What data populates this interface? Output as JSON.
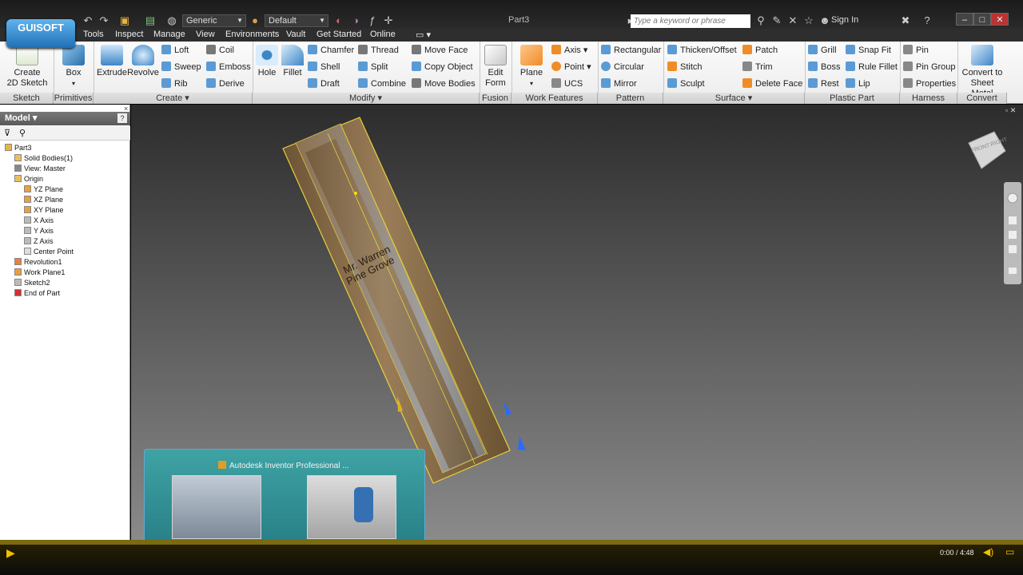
{
  "title_bar": {
    "style_combo": "Generic",
    "appearance_combo": "Default",
    "doc_title": "Part3",
    "search_placeholder": "Type a keyword or phrase",
    "sign_in": "Sign In",
    "logo_text": "GUISOFT"
  },
  "menu": [
    "Tools",
    "Inspect",
    "Manage",
    "View",
    "Environments",
    "Vault",
    "Get Started",
    "Online"
  ],
  "ribbon": {
    "sketch": {
      "create_2d_sketch": "Create\n2D Sketch",
      "panel": "Sketch"
    },
    "primitives": {
      "box": "Box",
      "panel": "Primitives"
    },
    "create": {
      "extrude": "Extrude",
      "revolve": "Revolve",
      "loft": "Loft",
      "coil": "Coil",
      "sweep": "Sweep",
      "emboss": "Emboss",
      "rib": "Rib",
      "derive": "Derive",
      "panel": "Create"
    },
    "modify": {
      "hole": "Hole",
      "fillet": "Fillet",
      "chamfer": "Chamfer",
      "thread": "Thread",
      "shell": "Shell",
      "split": "Split",
      "draft": "Draft",
      "combine": "Combine",
      "move_face": "Move Face",
      "copy_object": "Copy Object",
      "move_bodies": "Move Bodies",
      "panel": "Modify"
    },
    "fusion": {
      "edit_form": "Edit\nForm",
      "panel": "Fusion"
    },
    "work_features": {
      "plane": "Plane",
      "axis": "Axis",
      "point": "Point",
      "ucs": "UCS",
      "panel": "Work Features"
    },
    "pattern": {
      "rectangular": "Rectangular",
      "circular": "Circular",
      "mirror": "Mirror",
      "panel": "Pattern"
    },
    "surface": {
      "thicken_offset": "Thicken/Offset",
      "stitch": "Stitch",
      "sculpt": "Sculpt",
      "patch": "Patch",
      "trim": "Trim",
      "delete_face": "Delete Face",
      "panel": "Surface"
    },
    "plastic_part": {
      "grill": "Grill",
      "boss": "Boss",
      "rest": "Rest",
      "snap_fit": "Snap Fit",
      "rule_fillet": "Rule Fillet",
      "lip": "Lip",
      "panel": "Plastic Part"
    },
    "harness": {
      "pin": "Pin",
      "pin_group": "Pin Group",
      "properties": "Properties",
      "panel": "Harness"
    },
    "convert": {
      "convert_to_sheet_metal": "Convert to\nSheet Metal",
      "panel": "Convert"
    }
  },
  "browser": {
    "title": "Model",
    "tree": [
      {
        "label": "Part3",
        "indent": 0
      },
      {
        "label": "Solid Bodies(1)",
        "indent": 1
      },
      {
        "label": "View: Master",
        "indent": 1
      },
      {
        "label": "Origin",
        "indent": 1
      },
      {
        "label": "YZ Plane",
        "indent": 2
      },
      {
        "label": "XZ Plane",
        "indent": 2
      },
      {
        "label": "XY Plane",
        "indent": 2
      },
      {
        "label": "X Axis",
        "indent": 2
      },
      {
        "label": "Y Axis",
        "indent": 2
      },
      {
        "label": "Z Axis",
        "indent": 2
      },
      {
        "label": "Center Point",
        "indent": 2
      },
      {
        "label": "Revolution1",
        "indent": 1
      },
      {
        "label": "Work Plane1",
        "indent": 1
      },
      {
        "label": "Sketch2",
        "indent": 1
      },
      {
        "label": "End of Part",
        "indent": 1
      }
    ]
  },
  "viewport": {
    "engraving_line1": "Mr. Warren",
    "engraving_line2": "Pine Grove",
    "viewcube_front": "FRONT",
    "viewcube_right": "RIGHT"
  },
  "taskbar_preview": {
    "title": "Autodesk Inventor Professional ..."
  },
  "video": {
    "time": "0:00 / 4:48"
  },
  "colors": {
    "accent": "#f0a000",
    "highlight": "#e8d23a",
    "ribbon_bg": "#f3f3f3"
  }
}
